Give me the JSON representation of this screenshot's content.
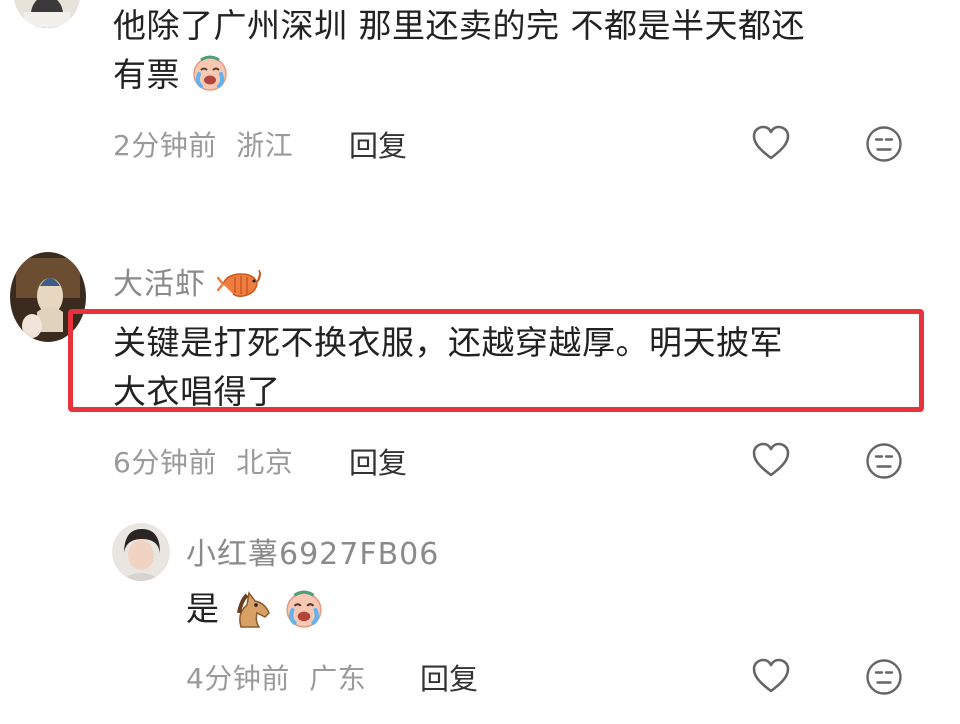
{
  "comments": [
    {
      "text_line1": "他除了广州深圳 那里还卖的完 不都是半天都还",
      "text_line2": "有票",
      "time": "2分钟前",
      "location": "浙江",
      "reply_label": "回复"
    },
    {
      "username": "大活虾",
      "text_line1": "关键是打死不换衣服，还越穿越厚。明天披军",
      "text_line2": "大衣唱得了",
      "time": "6分钟前",
      "location": "北京",
      "reply_label": "回复",
      "highlighted": true,
      "highlight_color": "#e8323c",
      "replies": [
        {
          "username": "小红薯6927FB06",
          "text": "是",
          "emojis": [
            "horse-emoji",
            "crying-laugh-emoji"
          ],
          "time": "4分钟前",
          "location": "广东",
          "reply_label": "回复"
        }
      ]
    }
  ],
  "icons": {
    "like": "heart-outline-icon",
    "dislike": "neutral-face-icon"
  }
}
